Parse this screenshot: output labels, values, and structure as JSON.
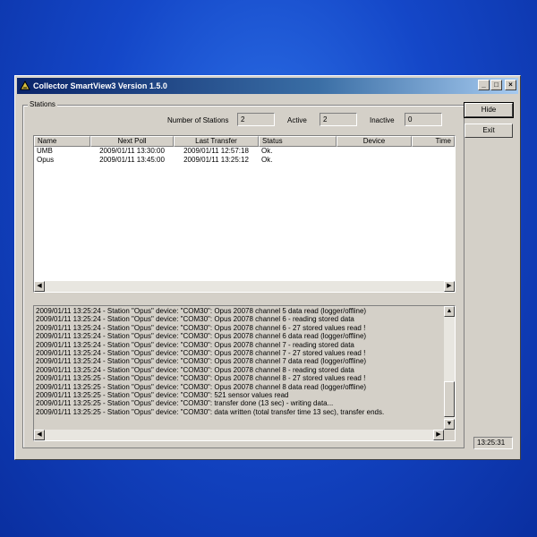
{
  "window": {
    "title": "Collector SmartView3 Version 1.5.0"
  },
  "stations": {
    "group_label": "Stations",
    "count_label": "Number of Stations",
    "count_value": "2",
    "active_label": "Active",
    "active_value": "2",
    "inactive_label": "Inactive",
    "inactive_value": "0"
  },
  "table": {
    "columns": [
      "Name",
      "Next Poll",
      "Last Transfer",
      "Status",
      "Device",
      "Time"
    ],
    "rows": [
      [
        "UMB",
        "2009/01/11 13:30:00",
        "2009/01/11 12:57:18",
        "Ok.",
        "",
        ""
      ],
      [
        "Opus",
        "2009/01/11 13:45:00",
        "2009/01/11 13:25:12",
        "Ok.",
        "",
        ""
      ]
    ]
  },
  "log": {
    "lines": [
      "2009/01/11 13:25:24 - Station \"Opus\" device: \"COM30\": Opus 20078 channel 5 data read (logger/offline)",
      "2009/01/11 13:25:24 - Station \"Opus\" device: \"COM30\": Opus 20078 channel 6 - reading stored data",
      "2009/01/11 13:25:24 - Station \"Opus\" device: \"COM30\": Opus 20078 channel 6 - 27 stored values read !",
      "2009/01/11 13:25:24 - Station \"Opus\" device: \"COM30\": Opus 20078 channel 6 data read (logger/offline)",
      "2009/01/11 13:25:24 - Station \"Opus\" device: \"COM30\": Opus 20078 channel 7 - reading stored data",
      "2009/01/11 13:25:24 - Station \"Opus\" device: \"COM30\": Opus 20078 channel 7 - 27 stored values read !",
      "2009/01/11 13:25:24 - Station \"Opus\" device: \"COM30\": Opus 20078 channel 7 data read (logger/offline)",
      "2009/01/11 13:25:24 - Station \"Opus\" device: \"COM30\": Opus 20078 channel 8 - reading stored data",
      "2009/01/11 13:25:25 - Station \"Opus\" device: \"COM30\": Opus 20078 channel 8 - 27 stored values read !",
      "2009/01/11 13:25:25 - Station \"Opus\" device: \"COM30\": Opus 20078 channel 8 data read (logger/offline)",
      "2009/01/11 13:25:25 - Station \"Opus\" device: \"COM30\": 521 sensor values read",
      "2009/01/11 13:25:25 - Station \"Opus\" device: \"COM30\": transfer done (13 sec) - writing data...",
      "2009/01/11 13:25:25 - Station \"Opus\" device: \"COM30\": data written (total transfer time 13 sec), transfer ends."
    ]
  },
  "buttons": {
    "hide": "Hide",
    "exit": "Exit"
  },
  "clock": "13:25:31",
  "icons": {
    "minimize": "minimize-icon",
    "maximize": "maximize-icon",
    "close": "close-icon",
    "left": "arrow-left-icon",
    "right": "arrow-right-icon",
    "up": "arrow-up-icon",
    "down": "arrow-down-icon"
  },
  "colors": {
    "titlebar_start": "#0a246a",
    "titlebar_end": "#a6caf0",
    "desktop": "#1447c8",
    "face": "#d4d0c8"
  }
}
